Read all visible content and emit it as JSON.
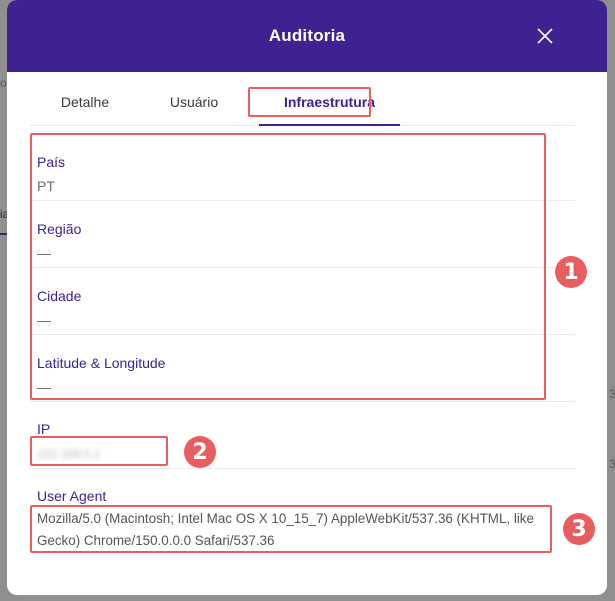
{
  "modal": {
    "title": "Auditoria"
  },
  "tabs": [
    {
      "label": "Detalhe",
      "active": false
    },
    {
      "label": "Usuário",
      "active": false
    },
    {
      "label": "Infraestrutura",
      "active": true
    }
  ],
  "fields": {
    "country": {
      "label": "País",
      "value": "PT"
    },
    "region": {
      "label": "Região",
      "value": "—"
    },
    "city": {
      "label": "Cidade",
      "value": "—"
    },
    "latlng": {
      "label": "Latitude & Longitude",
      "value": "—"
    },
    "ip": {
      "label": "IP",
      "value": "192.168.0.1"
    },
    "user_agent": {
      "label": "User Agent",
      "value": "Mozilla/5.0 (Macintosh; Intel Mac OS X 10_15_7) AppleWebKit/537.36 (KHTML, like Gecko) Chrome/150.0.0.0 Safari/537.36"
    }
  },
  "annotations": [
    "1",
    "2",
    "3"
  ],
  "background": {
    "left_char": "ia",
    "dot": "o",
    "right_digit_1": "3",
    "right_digit_2": "3"
  },
  "colors": {
    "accent": "#3f2191",
    "annotation": "#e85d60"
  }
}
